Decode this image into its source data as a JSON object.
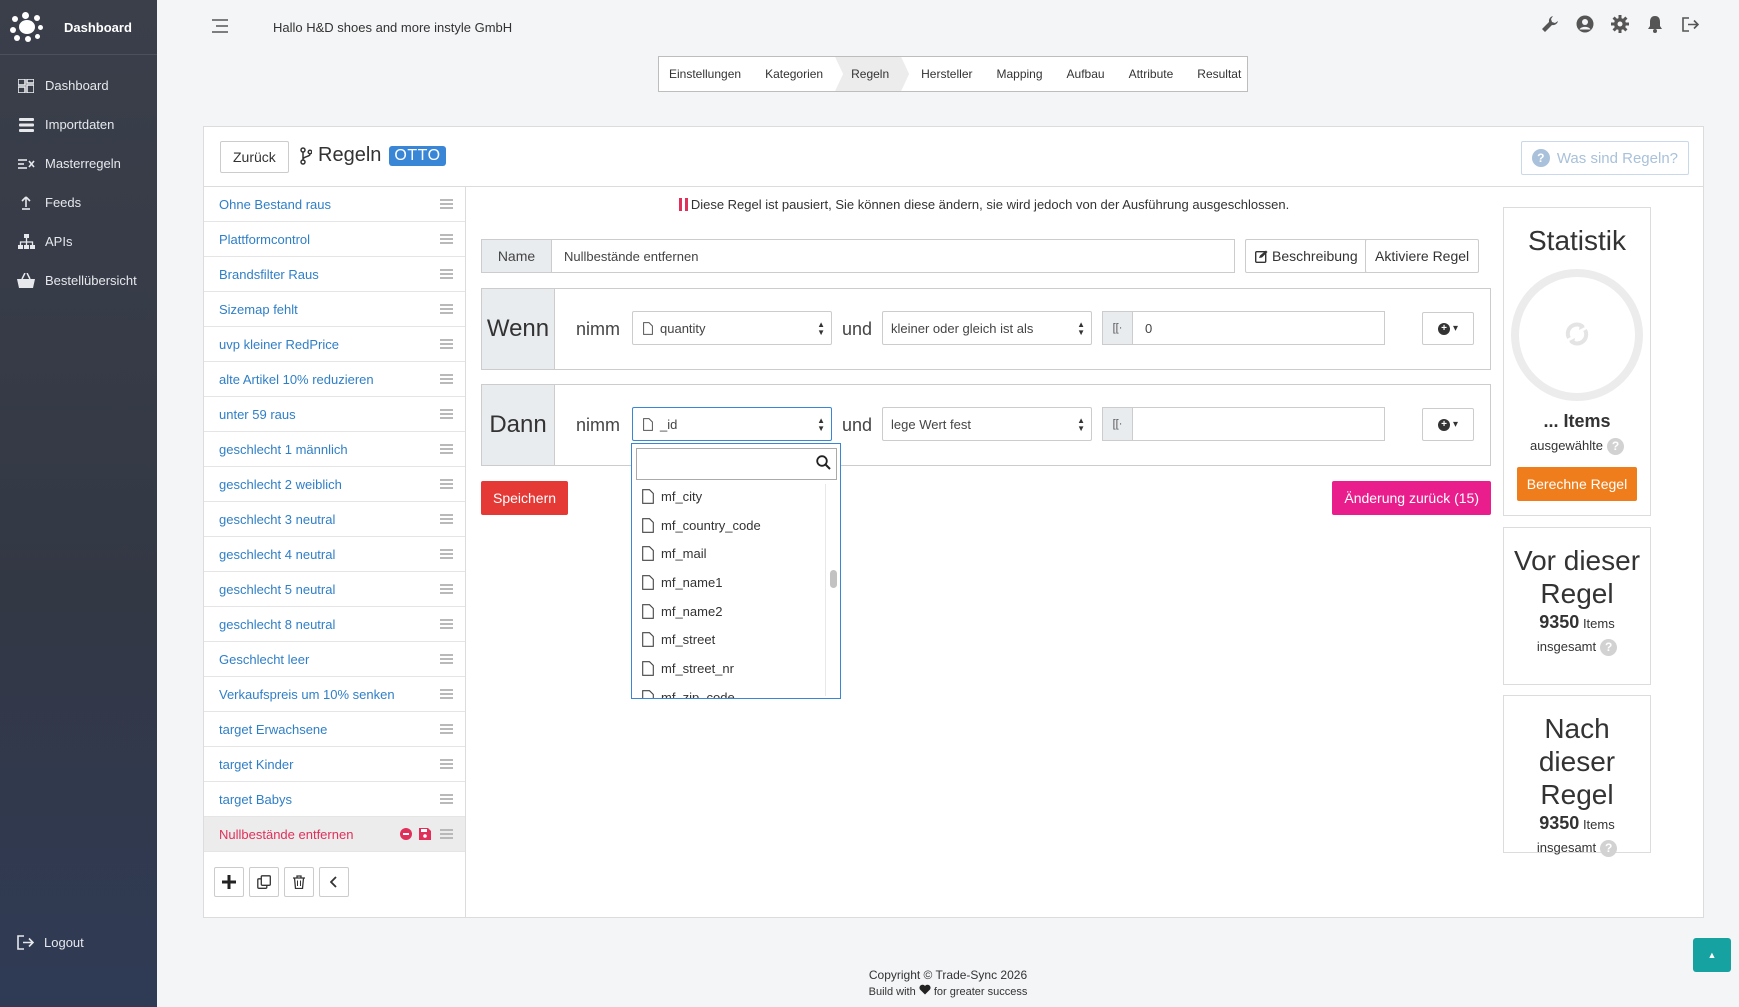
{
  "sidebar": {
    "brand": "Dashboard",
    "items": [
      {
        "label": "Dashboard",
        "icon": "dashboard-icon"
      },
      {
        "label": "Importdaten",
        "icon": "database-icon"
      },
      {
        "label": "Masterregeln",
        "icon": "rules-icon"
      },
      {
        "label": "Feeds",
        "icon": "upload-icon"
      },
      {
        "label": "APIs",
        "icon": "sitemap-icon"
      },
      {
        "label": "Bestellübersicht",
        "icon": "basket-icon"
      }
    ],
    "logout": "Logout"
  },
  "header": {
    "greeting": "Hallo H&D shoes and more instyle GmbH",
    "icons": [
      "wrench-icon",
      "user-icon",
      "gear-icon",
      "bell-icon",
      "logout-icon"
    ]
  },
  "steps": {
    "items": [
      "Einstellungen",
      "Kategorien",
      "Regeln",
      "Hersteller",
      "Mapping",
      "Aufbau",
      "Attribute",
      "Resultat"
    ],
    "active": "Regeln"
  },
  "panel": {
    "back_label": "Zurück",
    "title": "Regeln",
    "badge": "OTTO",
    "help": "Was sind Regeln?"
  },
  "rules": {
    "items": [
      "Ohne Bestand raus",
      "Plattformcontrol",
      "Brandsfilter Raus",
      "Sizemap fehlt",
      "uvp kleiner RedPrice",
      "alte Artikel 10% reduzieren",
      "unter 59 raus",
      "geschlecht 1 männlich",
      "geschlecht 2 weiblich",
      "geschlecht 3 neutral",
      "geschlecht 4 neutral",
      "geschlecht 5 neutral",
      "geschlecht 8 neutral",
      "Geschlecht leer",
      "Verkaufspreis um 10% senken",
      "target Erwachsene",
      "target Kinder",
      "target Babys"
    ],
    "active": "Nullbestände entfernen"
  },
  "editor": {
    "pause_message": "Diese Regel ist pausiert, Sie können diese ändern, sie wird jedoch von der Ausführung ausgeschlossen.",
    "name_label": "Name",
    "name_value": "Nullbestände entfernen",
    "describe_label": "Beschreibung",
    "activate_label": "Aktiviere Regel",
    "when": {
      "word": "Wenn",
      "nimm": "nimm",
      "field": "quantity",
      "und": "und",
      "operator": "kleiner oder gleich ist als",
      "value": "0"
    },
    "then": {
      "word": "Dann",
      "nimm": "nimm",
      "field": "_id",
      "und": "und",
      "operator": "lege Wert fest",
      "value": ""
    },
    "save_label": "Speichern",
    "revert_label": "Änderung zurück (15)"
  },
  "dropdown": {
    "search_placeholder": "",
    "options": [
      "mf_city",
      "mf_country_code",
      "mf_mail",
      "mf_name1",
      "mf_name2",
      "mf_street",
      "mf_street_nr",
      "mf_zip_code"
    ]
  },
  "stats": {
    "title": "Statistik",
    "items_label": "... Items",
    "selected_label": "ausgewählte",
    "calc_label": "Berechne Regel",
    "before": {
      "title": "Vor dieser Regel",
      "count": "9350",
      "unit": "Items",
      "total": "insgesamt"
    },
    "after": {
      "title": "Nach dieser Regel",
      "count": "9350",
      "unit": "Items",
      "total": "insgesamt"
    }
  },
  "footer": {
    "copyright": "Copyright © Trade-Sync 2026",
    "sub_before": "Build with",
    "sub_after": "for greater success"
  },
  "colors": {
    "accent": "#3a86d6",
    "danger": "#e53935",
    "pink": "#e91e8c",
    "orange": "#ef7d1b",
    "teal": "#17a2a2"
  }
}
